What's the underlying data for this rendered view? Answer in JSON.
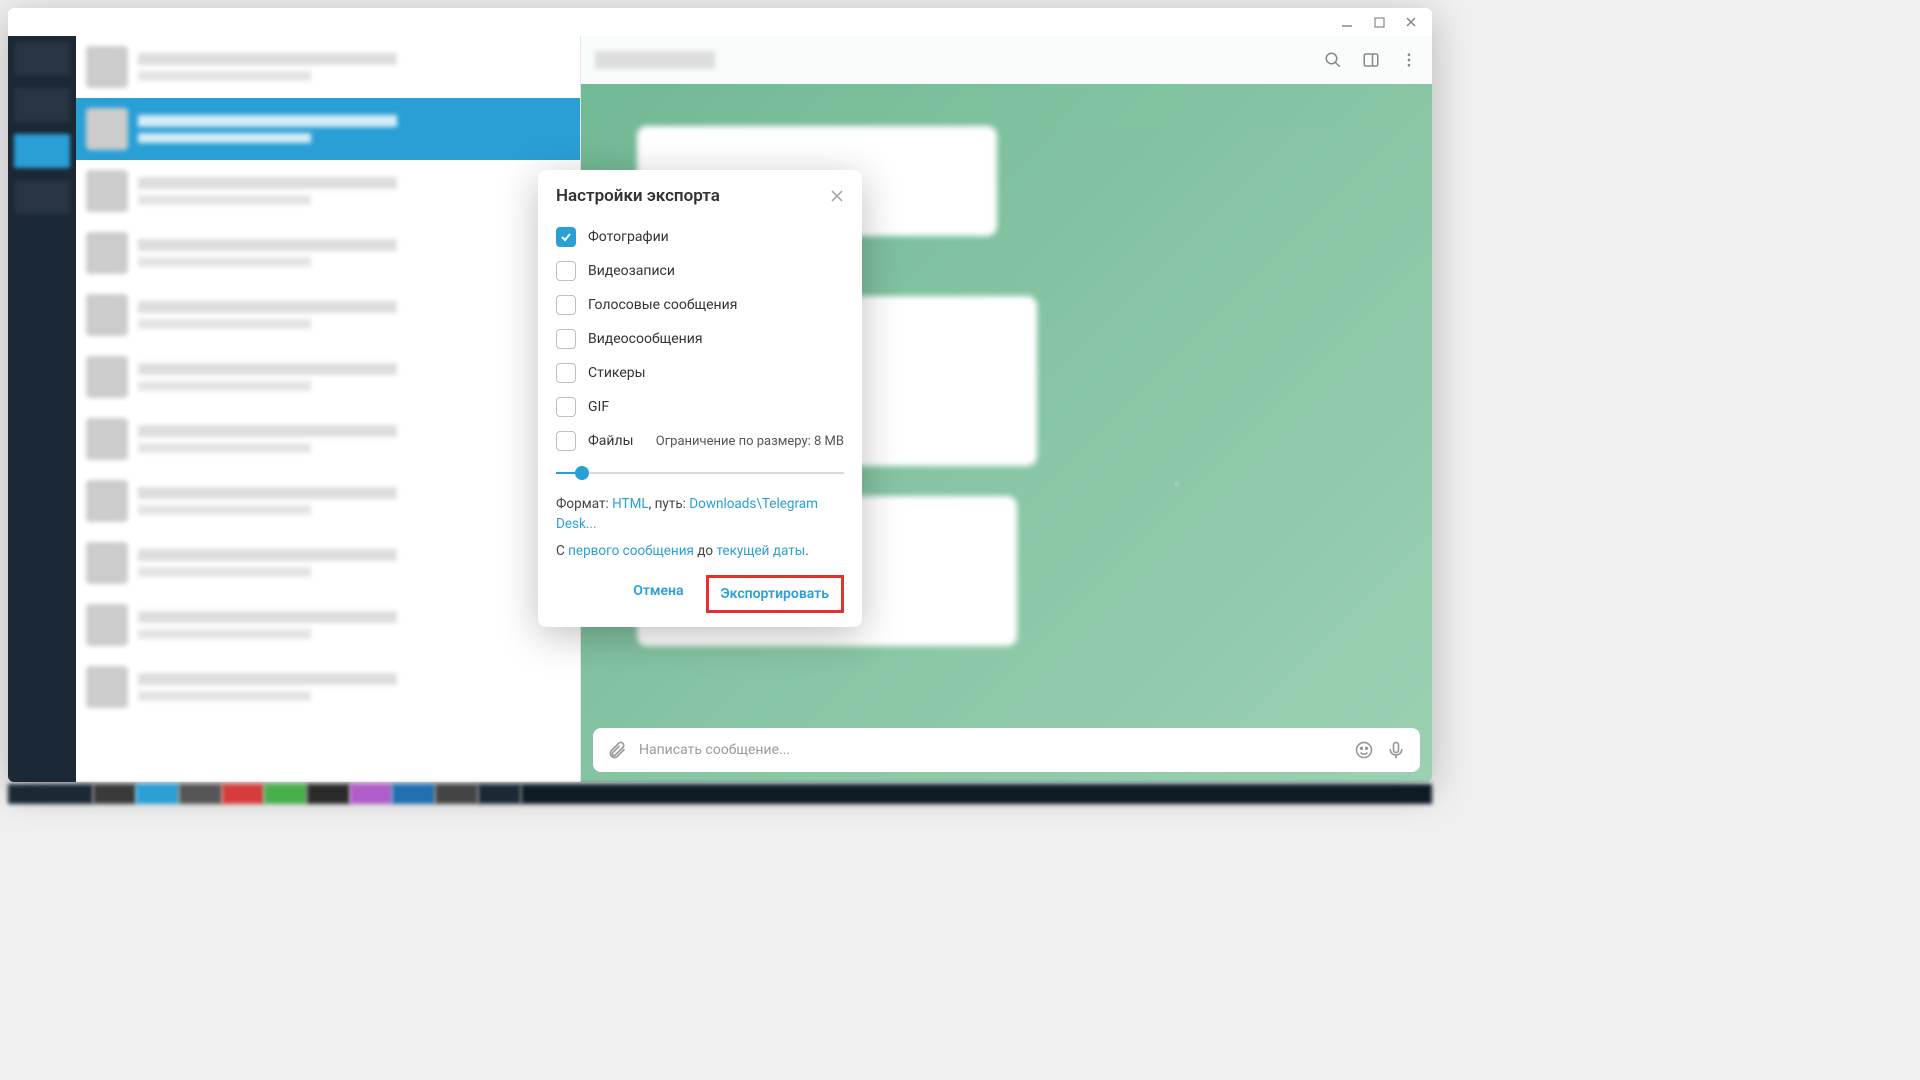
{
  "window_controls": {
    "minimize": "minimize",
    "maximize": "maximize",
    "close": "close"
  },
  "header_icons": {
    "search": "search",
    "panel": "panel",
    "menu": "menu"
  },
  "modal": {
    "title": "Настройки экспорта",
    "options": {
      "photos": {
        "label": "Фотографии",
        "checked": true
      },
      "videos": {
        "label": "Видеозаписи",
        "checked": false
      },
      "voice": {
        "label": "Голосовые сообщения",
        "checked": false
      },
      "vmsg": {
        "label": "Видеосообщения",
        "checked": false
      },
      "stickers": {
        "label": "Стикеры",
        "checked": false
      },
      "gif": {
        "label": "GIF",
        "checked": false
      },
      "files": {
        "label": "Файлы",
        "checked": false
      }
    },
    "size_limit_label": "Ограничение по размеру: 8 МВ",
    "slider_percent": 9,
    "format_line": {
      "prefix": "Формат: ",
      "format": "HTML",
      "mid": ", путь: ",
      "path": "Downloads\\Telegram Desk..."
    },
    "range_line": {
      "prefix": "С ",
      "from": "первого сообщения",
      "mid": " до ",
      "to": "текущей даты",
      "suffix": "."
    },
    "cancel": "Отмена",
    "export": "Экспортировать"
  },
  "composer": {
    "placeholder": "Написать сообщение..."
  }
}
